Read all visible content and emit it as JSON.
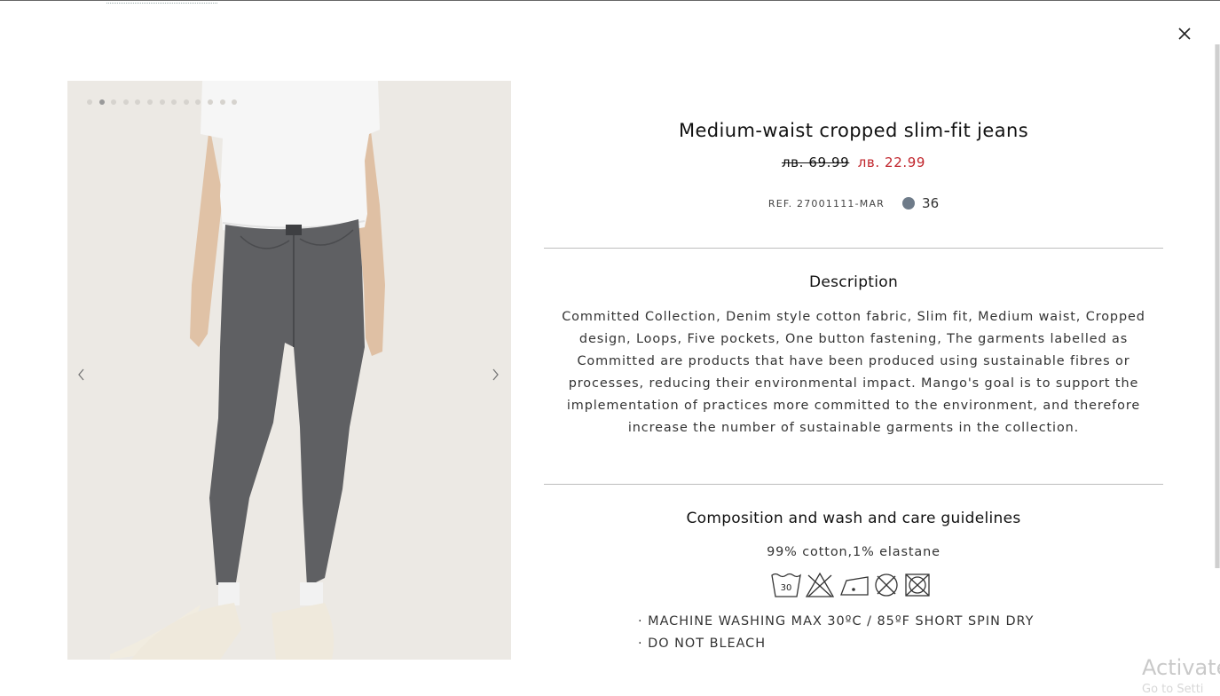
{
  "dialog": {
    "close_icon": "close-icon"
  },
  "gallery": {
    "dot_count": 13,
    "active_dot_index": 1,
    "prev_icon": "chevron-left-icon",
    "next_icon": "chevron-right-icon"
  },
  "product": {
    "title": "Medium-waist cropped slim-fit jeans",
    "old_price": "лв. 69.99",
    "new_price": "лв. 22.99",
    "ref": "REF. 27001111-MAR",
    "color_code": "36",
    "color_swatch": "#6e7b89",
    "sale_color": "#c1262d"
  },
  "description": {
    "heading": "Description",
    "text": "Committed Collection, Denim style cotton fabric, Slim fit, Medium waist, Cropped design, Loops, Five pockets, One button fastening, The garments labelled as Committed are products that have been produced using sustainable fibres or processes, reducing their environmental impact. Mango's goal is to support the implementation of practices more committed to the environment, and therefore increase the number of sustainable garments in the collection."
  },
  "care": {
    "heading": "Composition and wash and care guidelines",
    "composition": "99% cotton,1% elastane",
    "wash_temp": "30",
    "icons": [
      "wash-30-icon",
      "no-bleach-icon",
      "iron-low-icon",
      "no-dry-clean-icon",
      "no-tumble-dry-icon"
    ],
    "instructions": [
      "· MACHINE WASHING MAX 30ºC / 85ºF SHORT SPIN DRY",
      "· DO NOT BLEACH"
    ]
  },
  "watermark": {
    "title": "Activate",
    "subtitle": "Go to Setti"
  }
}
